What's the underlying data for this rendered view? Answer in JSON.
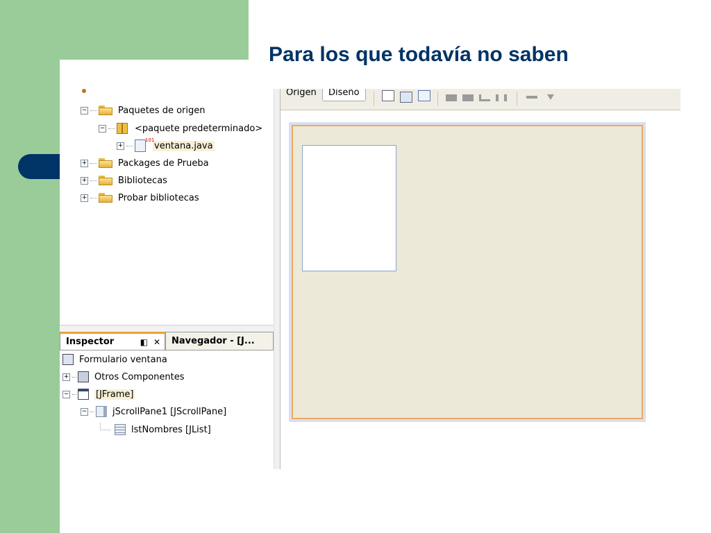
{
  "slide": {
    "title": "Para los que todavía no saben"
  },
  "project_tree": {
    "items": [
      {
        "label": "Paquetes de origen",
        "icon": "folder-icon",
        "expand": "−"
      },
      {
        "label": "<paquete predeterminado>",
        "icon": "package-icon",
        "expand": "−"
      },
      {
        "label": "ventana.java",
        "icon": "java-file-icon",
        "expand": "+"
      },
      {
        "label": "Packages de Prueba",
        "icon": "folder-icon",
        "expand": "+"
      },
      {
        "label": "Bibliotecas",
        "icon": "library-folder-icon",
        "expand": "+"
      },
      {
        "label": "Probar bibliotecas",
        "icon": "library-folder-icon",
        "expand": "+"
      }
    ]
  },
  "tabs": {
    "inspector": "Inspector",
    "navegador": "Navegador - [J...",
    "pin_glyph": "◧",
    "close_glyph": "✕"
  },
  "inspector_tree": {
    "items": [
      {
        "label": "Formulario ventana",
        "icon": "form-icon",
        "expand": ""
      },
      {
        "label": "Otros Componentes",
        "icon": "components-icon",
        "expand": "+"
      },
      {
        "label": "[JFrame]",
        "icon": "jframe-icon",
        "expand": "−"
      },
      {
        "label": "jScrollPane1 [JScrollPane]",
        "icon": "scrollpane-icon",
        "expand": "−"
      },
      {
        "label": "lstNombres [JList]",
        "icon": "jlist-icon",
        "expand": ""
      }
    ]
  },
  "editor_toolbar": {
    "origen": "Origen",
    "diseno": "Diseño"
  },
  "colors": {
    "accent_green": "#99cc99",
    "title_blue": "#003366",
    "form_bg": "#ece9d8",
    "form_border": "#f0a860",
    "tab_highlight": "#f0a030"
  }
}
